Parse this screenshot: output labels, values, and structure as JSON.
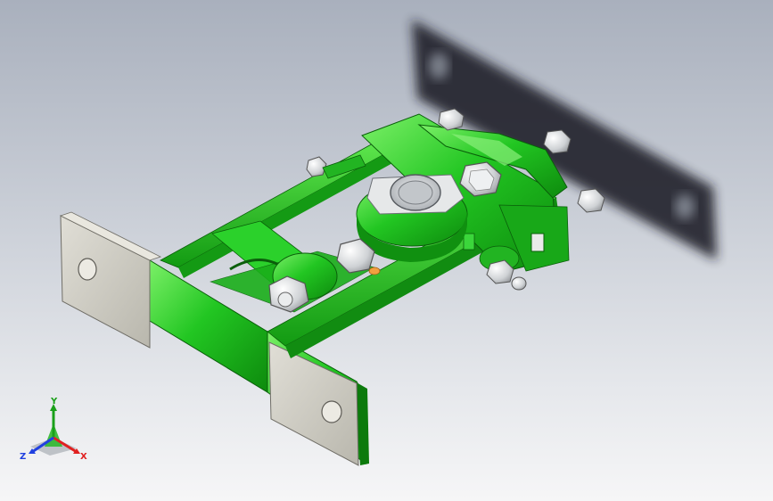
{
  "colors": {
    "part_green": "#1fc21f",
    "part_green_dark": "#0c7a0c",
    "part_green_light": "#8af07a",
    "plate_grey": "#cfcdc3",
    "plate_edge": "#8e8c84",
    "steel": "#d8dadc",
    "shadow": "#1c1f26",
    "axis_x": "#e02020",
    "axis_y": "#1aa01a",
    "axis_z": "#2040e0"
  },
  "triad": {
    "x_label": "X",
    "y_label": "Y",
    "z_label": "Z"
  }
}
